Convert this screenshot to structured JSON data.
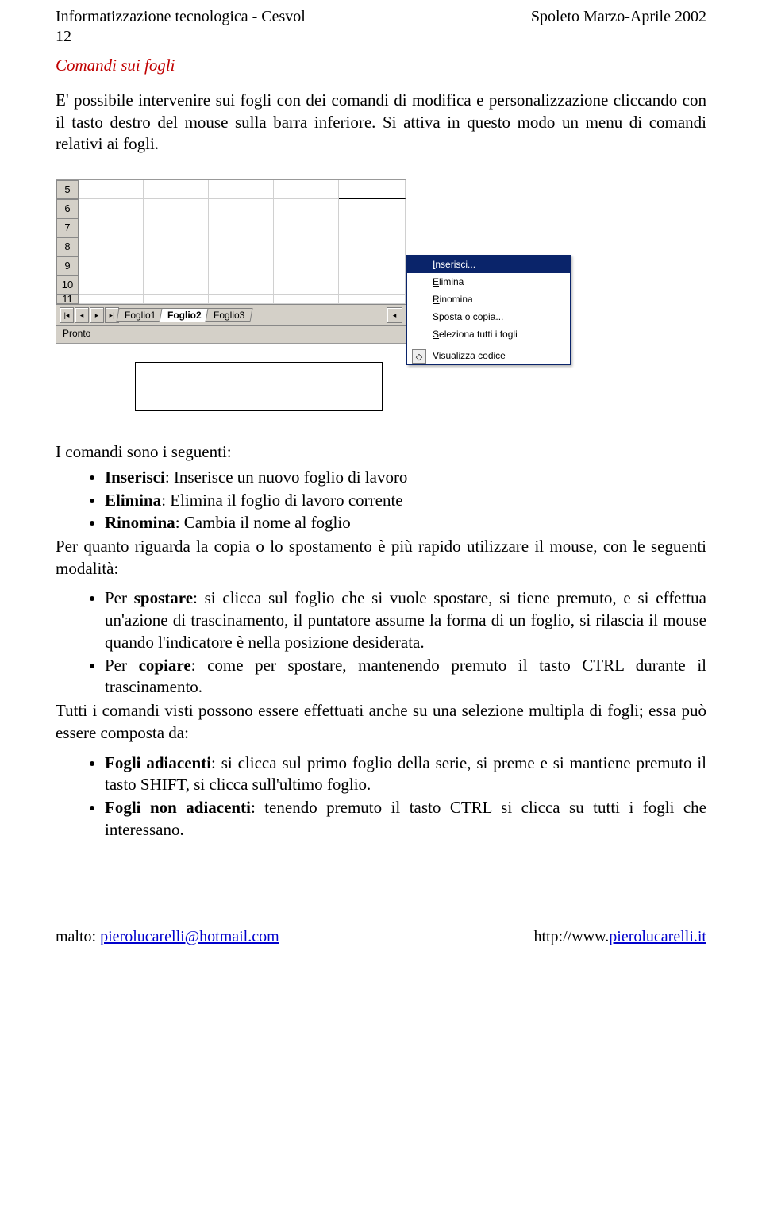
{
  "header": {
    "left": "Informatizzazione tecnologica - Cesvol",
    "right": "Spoleto Marzo-Aprile 2002"
  },
  "page_number": "12",
  "section_title": "Comandi sui fogli",
  "intro": "E' possibile intervenire sui fogli con dei comandi di modifica e personalizzazione cliccando con il tasto destro del mouse sulla barra inferiore. Si attiva in questo modo un menu di comandi relativi ai fogli.",
  "sheet": {
    "rows": [
      "5",
      "6",
      "7",
      "8",
      "9",
      "10",
      "11"
    ],
    "tabs": [
      "Foglio1",
      "Foglio2",
      "Foglio3"
    ],
    "active_tab_index": 1,
    "status": "Pronto"
  },
  "context_menu": {
    "items": [
      {
        "label": "Inserisci...",
        "underline": "I"
      },
      {
        "label": "Elimina",
        "underline": "E"
      },
      {
        "label": "Rinomina",
        "underline": "R"
      },
      {
        "label": "Sposta o copia...",
        "underline": ""
      },
      {
        "label": "Seleziona tutti i fogli",
        "underline": "S"
      }
    ],
    "code_item": {
      "label": "Visualizza codice",
      "underline": "V",
      "icon": "code-icon"
    }
  },
  "lead": "I comandi sono i seguenti:",
  "cmd_list": [
    {
      "term": "Inserisci",
      "desc": ": Inserisce un nuovo foglio di lavoro"
    },
    {
      "term": "Elimina",
      "desc": ": Elimina il foglio di lavoro corrente"
    },
    {
      "term": "Rinomina",
      "desc": ": Cambia il nome al foglio"
    }
  ],
  "mid_para": "Per quanto riguarda la copia o lo spostamento è più rapido utilizzare il mouse, con le seguenti modalità:",
  "move_list": [
    {
      "prefix": "Per ",
      "term": "spostare",
      "desc": ": si clicca sul foglio che si vuole spostare, si tiene premuto, e si effettua un'azione di trascinamento, il puntatore assume la forma di un foglio, si rilascia il mouse quando l'indicatore è nella posizione desiderata."
    },
    {
      "prefix": "Per ",
      "term": "copiare",
      "desc": ": come per spostare, mantenendo premuto il tasto CTRL durante il trascinamento."
    }
  ],
  "tail_para": "Tutti i comandi visti possono essere effettuati anche su una selezione multipla di fogli; essa può essere composta da:",
  "sel_list": [
    {
      "term": "Fogli adiacenti",
      "desc": ": si clicca sul primo foglio della serie, si preme e si mantiene premuto il tasto SHIFT, si clicca sull'ultimo foglio."
    },
    {
      "term": "Fogli non adiacenti",
      "desc": ": tenendo premuto il tasto CTRL si clicca su tutti i fogli che interessano."
    }
  ],
  "footer": {
    "left_prefix": "malto: ",
    "left_link": "pierolucarelli@hotmail.com",
    "right_prefix": "http://www.",
    "right_link": "pierolucarelli.it"
  }
}
